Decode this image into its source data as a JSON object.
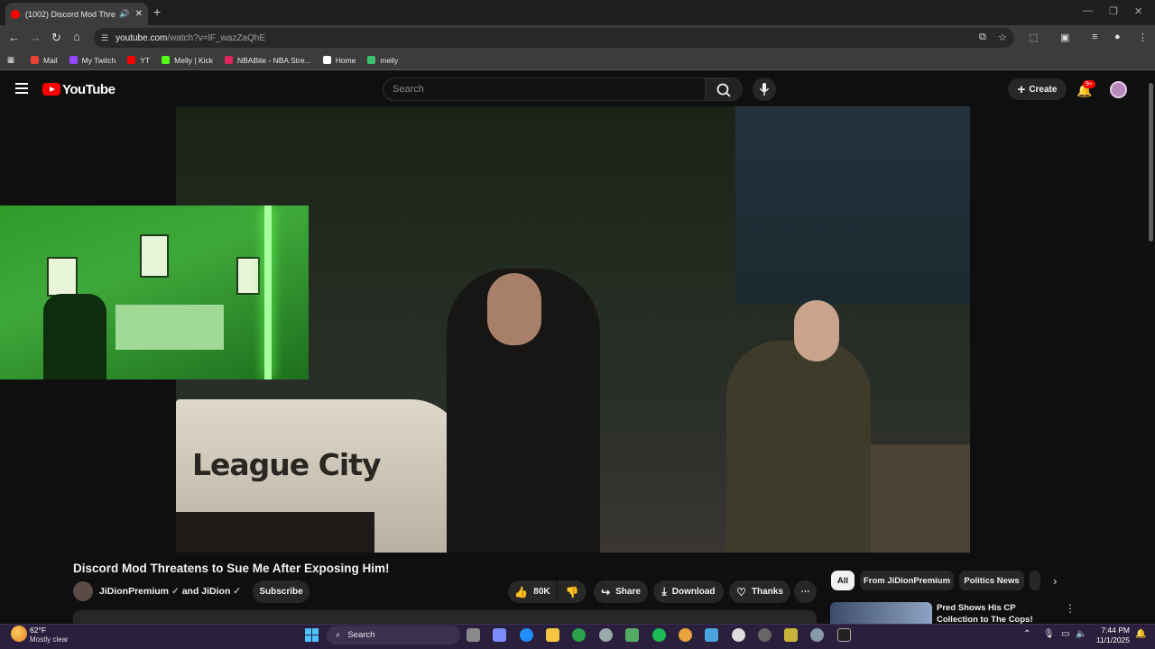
{
  "browser": {
    "tab_title": "(1002) Discord Mod Threatens to Sue Me After Exposing Him!",
    "url_host": "youtube.com",
    "url_path": "/watch?v=lF_wazZaQhE",
    "bookmarks": [
      {
        "label": "Mail",
        "color": "#ea4335"
      },
      {
        "label": "My Twitch",
        "color": "#9146ff"
      },
      {
        "label": "YT",
        "color": "#ff0000"
      },
      {
        "label": "Melly | Kick",
        "color": "#53fc18"
      },
      {
        "label": "NBABite - NBA Stre...",
        "color": "#e0245e"
      },
      {
        "label": "Home",
        "color": "#ffffff"
      },
      {
        "label": "melly",
        "color": "#3fbf6f"
      }
    ]
  },
  "youtube": {
    "logo_text": "YouTube",
    "search_placeholder": "Search",
    "create_label": "Create",
    "notification_badge": "9+",
    "video": {
      "car_text": "League City"
    },
    "title": "Discord Mod Threatens to Sue Me After Exposing Him!",
    "channel": "JiDionPremium",
    "channel_joiner": "and JiDion",
    "subscribe_label": "Subscribe",
    "likes": "80K",
    "share_label": "Share",
    "download_label": "Download",
    "thanks_label": "Thanks",
    "chips": [
      "All",
      "From JiDionPremium",
      "Politics News"
    ],
    "recommended_title": "Pred Shows His CP Collection to The Cops!"
  },
  "taskbar": {
    "temp": "62°F",
    "weather": "Mostly clear",
    "search_label": "Search",
    "time": "7:44 PM",
    "date": "11/1/2025"
  }
}
